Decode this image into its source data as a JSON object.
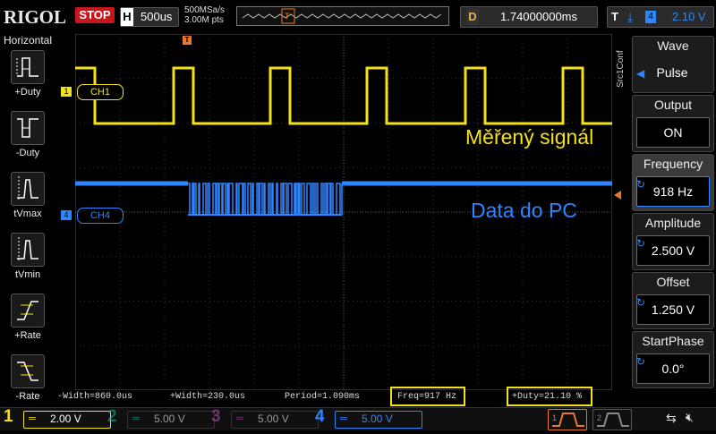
{
  "topbar": {
    "brand": "RIGOL",
    "run_state": "STOP",
    "horizontal_key": "H",
    "timebase": "500us",
    "sample_rate": "500MSa/s",
    "memory_depth": "3.00M pts",
    "delay_key": "D",
    "delay": "1.74000000ms",
    "trigger_key": "T",
    "trigger_source": "4",
    "trigger_level": "2.10 V"
  },
  "left_menu": {
    "title": "Horizontal",
    "items": [
      {
        "label": "+Duty",
        "icon": "positive-duty-icon"
      },
      {
        "label": "-Duty",
        "icon": "negative-duty-icon"
      },
      {
        "label": "tVmax",
        "icon": "tvmax-icon"
      },
      {
        "label": "tVmin",
        "icon": "tvmin-icon"
      },
      {
        "label": "+Rate",
        "icon": "rising-rate-icon"
      },
      {
        "label": "-Rate",
        "icon": "falling-rate-icon"
      }
    ]
  },
  "right_menu": {
    "side_label": "Src1Conf",
    "items": [
      {
        "title": "Wave",
        "value": "Pulse"
      },
      {
        "title": "Output",
        "value": "ON"
      },
      {
        "title": "Frequency",
        "value": "918 Hz"
      },
      {
        "title": "Amplitude",
        "value": "2.500 V"
      },
      {
        "title": "Offset",
        "value": "1.250 V"
      },
      {
        "title": "StartPhase",
        "value": "0.0°"
      }
    ]
  },
  "annotations": {
    "ch1_text": "Měřený signál",
    "ch4_text": "Data do PC"
  },
  "channel_tags": {
    "ch1": "CH1",
    "ch4": "CH4",
    "ch1_marker": "1",
    "ch4_marker": "4"
  },
  "measurements": {
    "neg_width": "-Width=860.0us",
    "pos_width": "+Width=230.0us",
    "period": "Period=1.090ms",
    "freq": "Freq=917 Hz",
    "duty": "+Duty=21.10 %"
  },
  "bottom": {
    "channels": [
      {
        "num": "1",
        "scale": "2.00 V",
        "color": "#f3e21a"
      },
      {
        "num": "2",
        "scale": "5.00 V",
        "color": "#1fb59a"
      },
      {
        "num": "3",
        "scale": "5.00 V",
        "color": "#c04fc0"
      },
      {
        "num": "4",
        "scale": "5.00 V",
        "color": "#2e86ff"
      }
    ]
  },
  "colors": {
    "ch1": "#f3e21a",
    "ch4": "#2e86ff",
    "trigger": "#e8772e",
    "stop": "#c8161d"
  }
}
